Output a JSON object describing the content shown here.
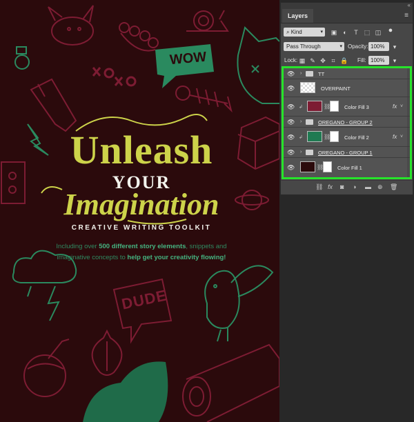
{
  "poster": {
    "title_line1": "Unleash",
    "title_line2": "YOUR",
    "title_line3": "Imagination",
    "subtitle": "CREATIVE WRITING TOOLKIT",
    "blurb_part1": "Including over ",
    "blurb_bold1": "500 different story elements",
    "blurb_part2": ", snippets and imaginative concepts to ",
    "blurb_bold2": "help get your creativity flowing!",
    "bubble_wow": "WOW",
    "bubble_xo": "XOXO",
    "bubble_dude": "DUDE",
    "colors": {
      "background": "#2b0a0c",
      "title": "#cdd34a",
      "doodle_red": "#7d1c33",
      "doodle_green": "#2a8a5f"
    }
  },
  "layers_panel": {
    "tab": "Layers",
    "menu_icon": "hamburger-icon",
    "filter_kind": "Kind",
    "blend_mode": "Pass Through",
    "opacity_label": "Opacity:",
    "opacity_value": "100%",
    "lock_label": "Lock:",
    "fill_label": "Fill:",
    "fill_value": "100%",
    "highlight_color": "#27e42a",
    "layers": [
      {
        "name": "TT",
        "type": "group"
      },
      {
        "name": "OVERPAINT",
        "type": "pixel"
      },
      {
        "name": "Color Fill 3",
        "type": "fill",
        "color": "#7d1c33",
        "fx": "fx"
      },
      {
        "name": "OREGANO - GROUP 2",
        "type": "group"
      },
      {
        "name": "Color Fill 2",
        "type": "fill",
        "color": "#1f7a52",
        "fx": "fx"
      },
      {
        "name": "OREGANO - GROUP 1",
        "type": "group"
      },
      {
        "name": "Color Fill 1",
        "type": "fill",
        "color": "#2b0a0c"
      }
    ]
  }
}
